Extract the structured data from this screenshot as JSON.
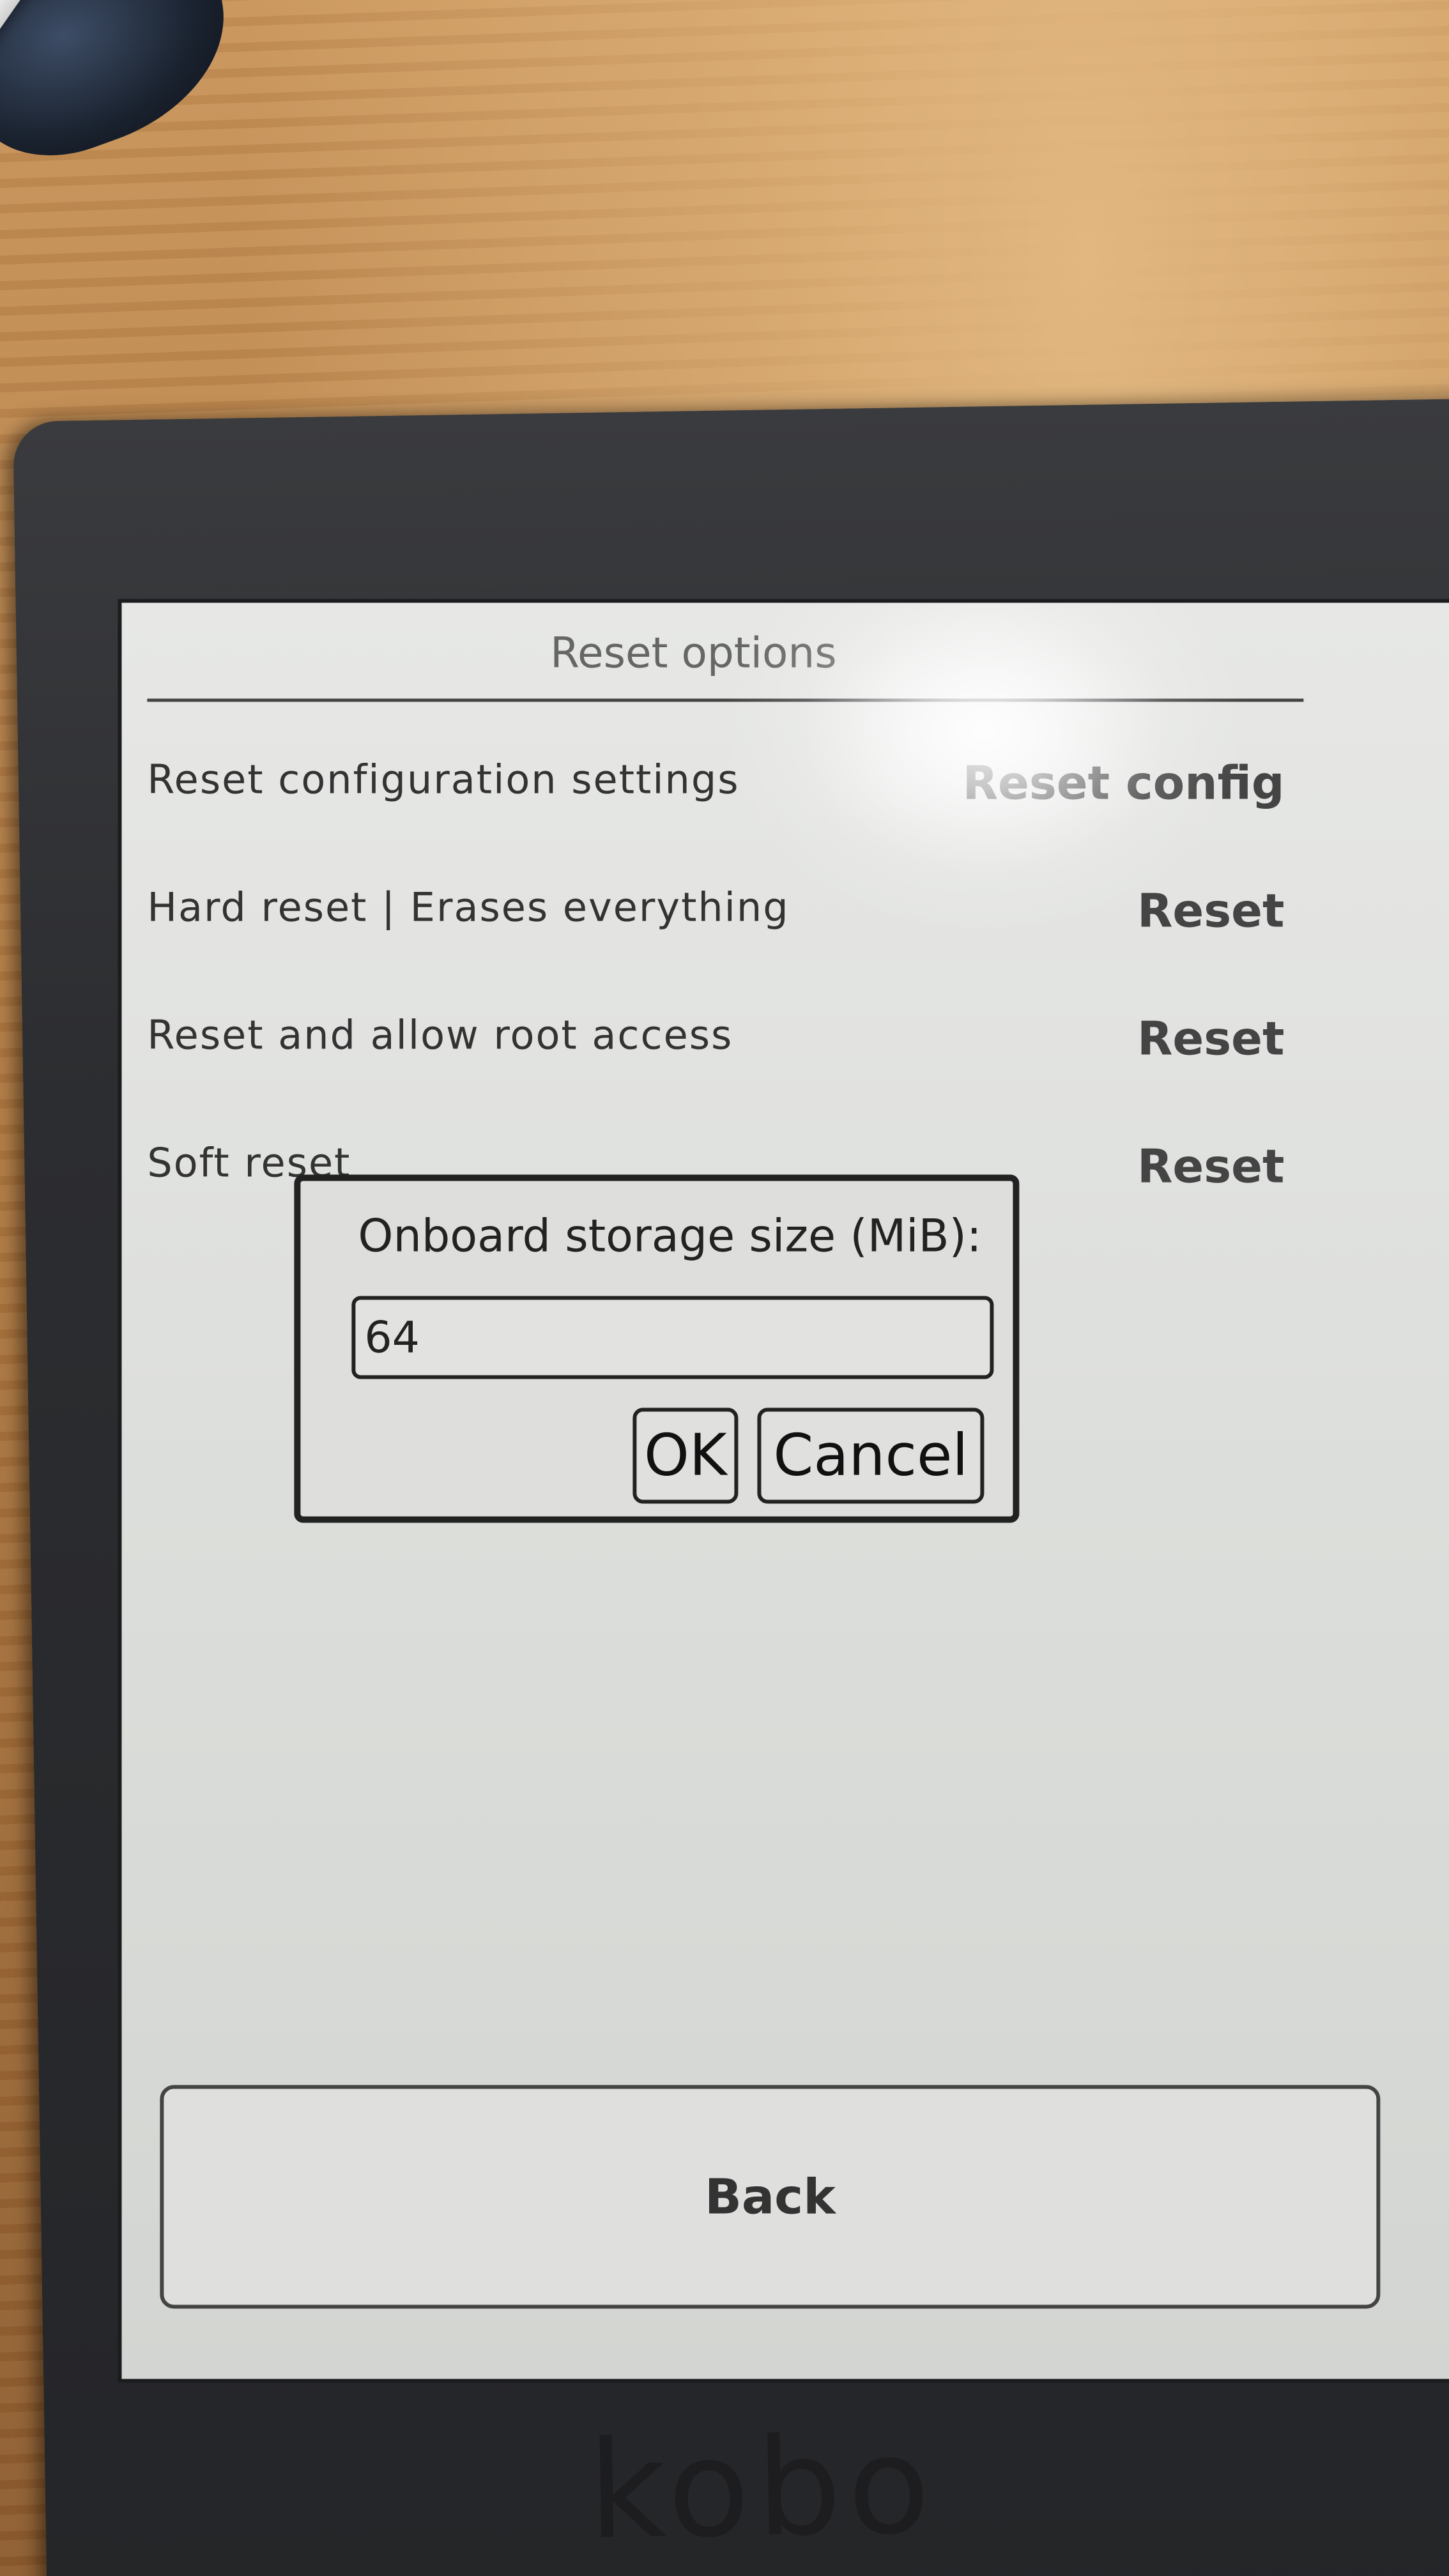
{
  "screen": {
    "title": "Reset options"
  },
  "options": [
    {
      "label": "Reset configuration settings",
      "button": "Reset config"
    },
    {
      "label": "Hard reset | Erases everything",
      "button": "Reset"
    },
    {
      "label": "Reset and allow root access",
      "button": "Reset"
    },
    {
      "label": "Soft reset",
      "button": "Reset"
    }
  ],
  "dialog": {
    "label": "Onboard storage size (MiB):",
    "value": "64",
    "ok_label": "OK",
    "cancel_label": "Cancel"
  },
  "back_label": "Back",
  "brand": "kobo"
}
